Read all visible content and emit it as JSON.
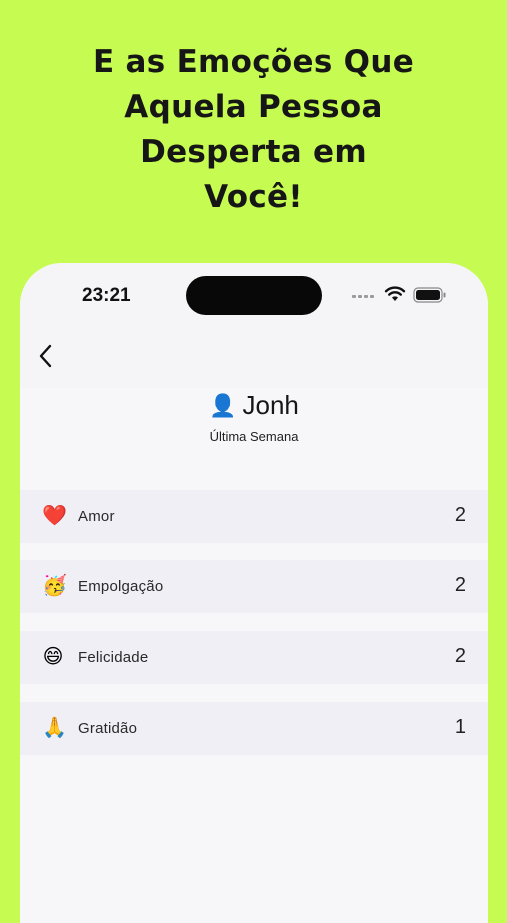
{
  "headline": {
    "line1": "E as Emoções Que",
    "line2": "Aquela Pessoa",
    "line3": "Desperta em",
    "line4": "Você!"
  },
  "status_bar": {
    "time": "23:21",
    "signal_icon": "cellular-signal-icon",
    "wifi_icon": "wifi-icon",
    "battery_icon": "battery-icon"
  },
  "nav": {
    "back_icon": "chevron-left-icon"
  },
  "person": {
    "avatar_icon": "person-silhouette-icon",
    "avatar_glyph": "👤",
    "name": "Jonh",
    "period": "Última Semana"
  },
  "emotions": [
    {
      "emoji": "❤️",
      "icon": "red-heart-icon",
      "label": "Amor",
      "count": "2"
    },
    {
      "emoji": "🥳",
      "icon": "party-face-icon",
      "label": "Empolgação",
      "count": "2"
    },
    {
      "emoji": "😄",
      "icon": "grinning-face-icon",
      "label": "Felicidade",
      "count": "2"
    },
    {
      "emoji": "🙏",
      "icon": "folded-hands-icon",
      "label": "Gratidão",
      "count": "1"
    }
  ],
  "colors": {
    "background": "#c6fb52",
    "screen": "#f7f7fa",
    "row": "#f0eff5",
    "text": "#161616"
  }
}
